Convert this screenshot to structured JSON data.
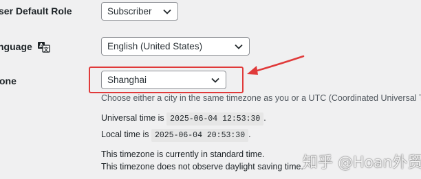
{
  "settings": {
    "default_role": {
      "label": "ser Default Role",
      "value": "Subscriber"
    },
    "language": {
      "label": "nguage",
      "value": "English (United States)",
      "icon": "translate-icon"
    },
    "timezone": {
      "label": "one",
      "value": "Shanghai",
      "description": "Choose either a city in the same timezone as you or a UTC (Coordinated Universal Time) ti"
    }
  },
  "time_info": {
    "universal_prefix": "Universal time is",
    "universal_value": "2025-06-04 12:53:30",
    "local_prefix": "Local time is",
    "local_value": "2025-06-04 20:53:30",
    "period": ".",
    "standard_time_note": "This timezone is currently in standard time.",
    "dst_note": "This timezone does not observe daylight saving time."
  },
  "annotation": {
    "color": "#e03a3a",
    "watermark": "知乎 @Hoan外贸J"
  }
}
